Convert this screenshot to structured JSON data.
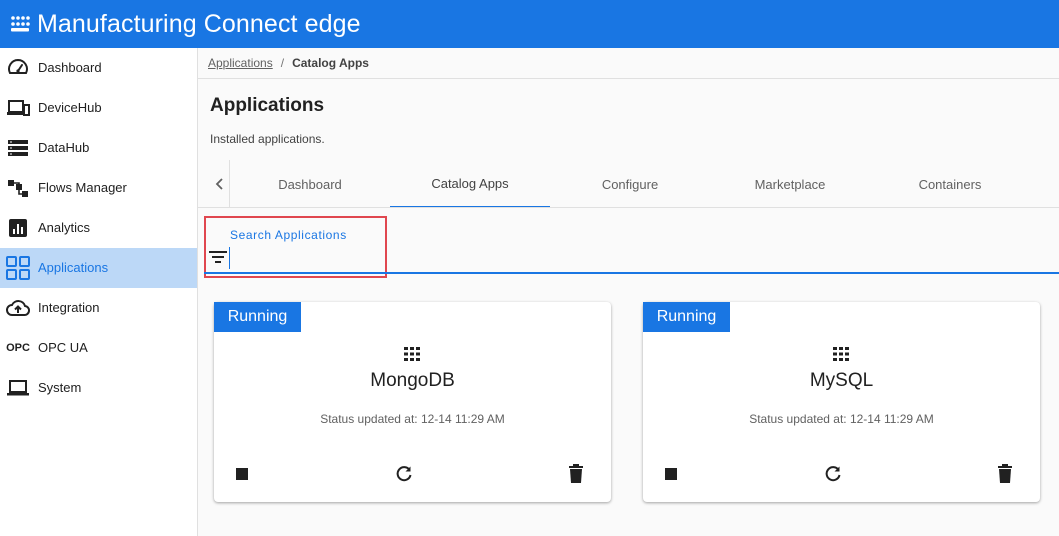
{
  "header": {
    "app_name": "Manufacturing Connect",
    "app_suffix": "edge",
    "logo_icon": "grid-dots-icon",
    "color": "#1976e3"
  },
  "sidebar": {
    "items": [
      {
        "label": "Dashboard",
        "icon": "speedometer-icon"
      },
      {
        "label": "DeviceHub",
        "icon": "devices-icon"
      },
      {
        "label": "DataHub",
        "icon": "storage-icon"
      },
      {
        "label": "Flows Manager",
        "icon": "flow-icon"
      },
      {
        "label": "Analytics",
        "icon": "analytics-icon"
      },
      {
        "label": "Applications",
        "icon": "apps-grid-icon",
        "active": true
      },
      {
        "label": "Integration",
        "icon": "cloud-upload-icon"
      },
      {
        "label": "OPC UA",
        "icon": "opc-text-icon",
        "icon_text": "OPC"
      },
      {
        "label": "System",
        "icon": "laptop-icon"
      }
    ]
  },
  "breadcrumb": {
    "parent": "Applications",
    "separator": "/",
    "current": "Catalog Apps"
  },
  "page": {
    "title": "Applications",
    "subtitle": "Installed applications."
  },
  "tabs": [
    {
      "label": "Dashboard"
    },
    {
      "label": "Catalog Apps",
      "active": true
    },
    {
      "label": "Configure"
    },
    {
      "label": "Marketplace"
    },
    {
      "label": "Containers"
    }
  ],
  "search": {
    "label": "Search Applications",
    "value": ""
  },
  "cards": [
    {
      "status_badge": "Running",
      "name": "MongoDB",
      "status_text": "Status updated at: 12-14 11:29 AM"
    },
    {
      "status_badge": "Running",
      "name": "MySQL",
      "status_text": "Status updated at: 12-14 11:29 AM"
    }
  ]
}
